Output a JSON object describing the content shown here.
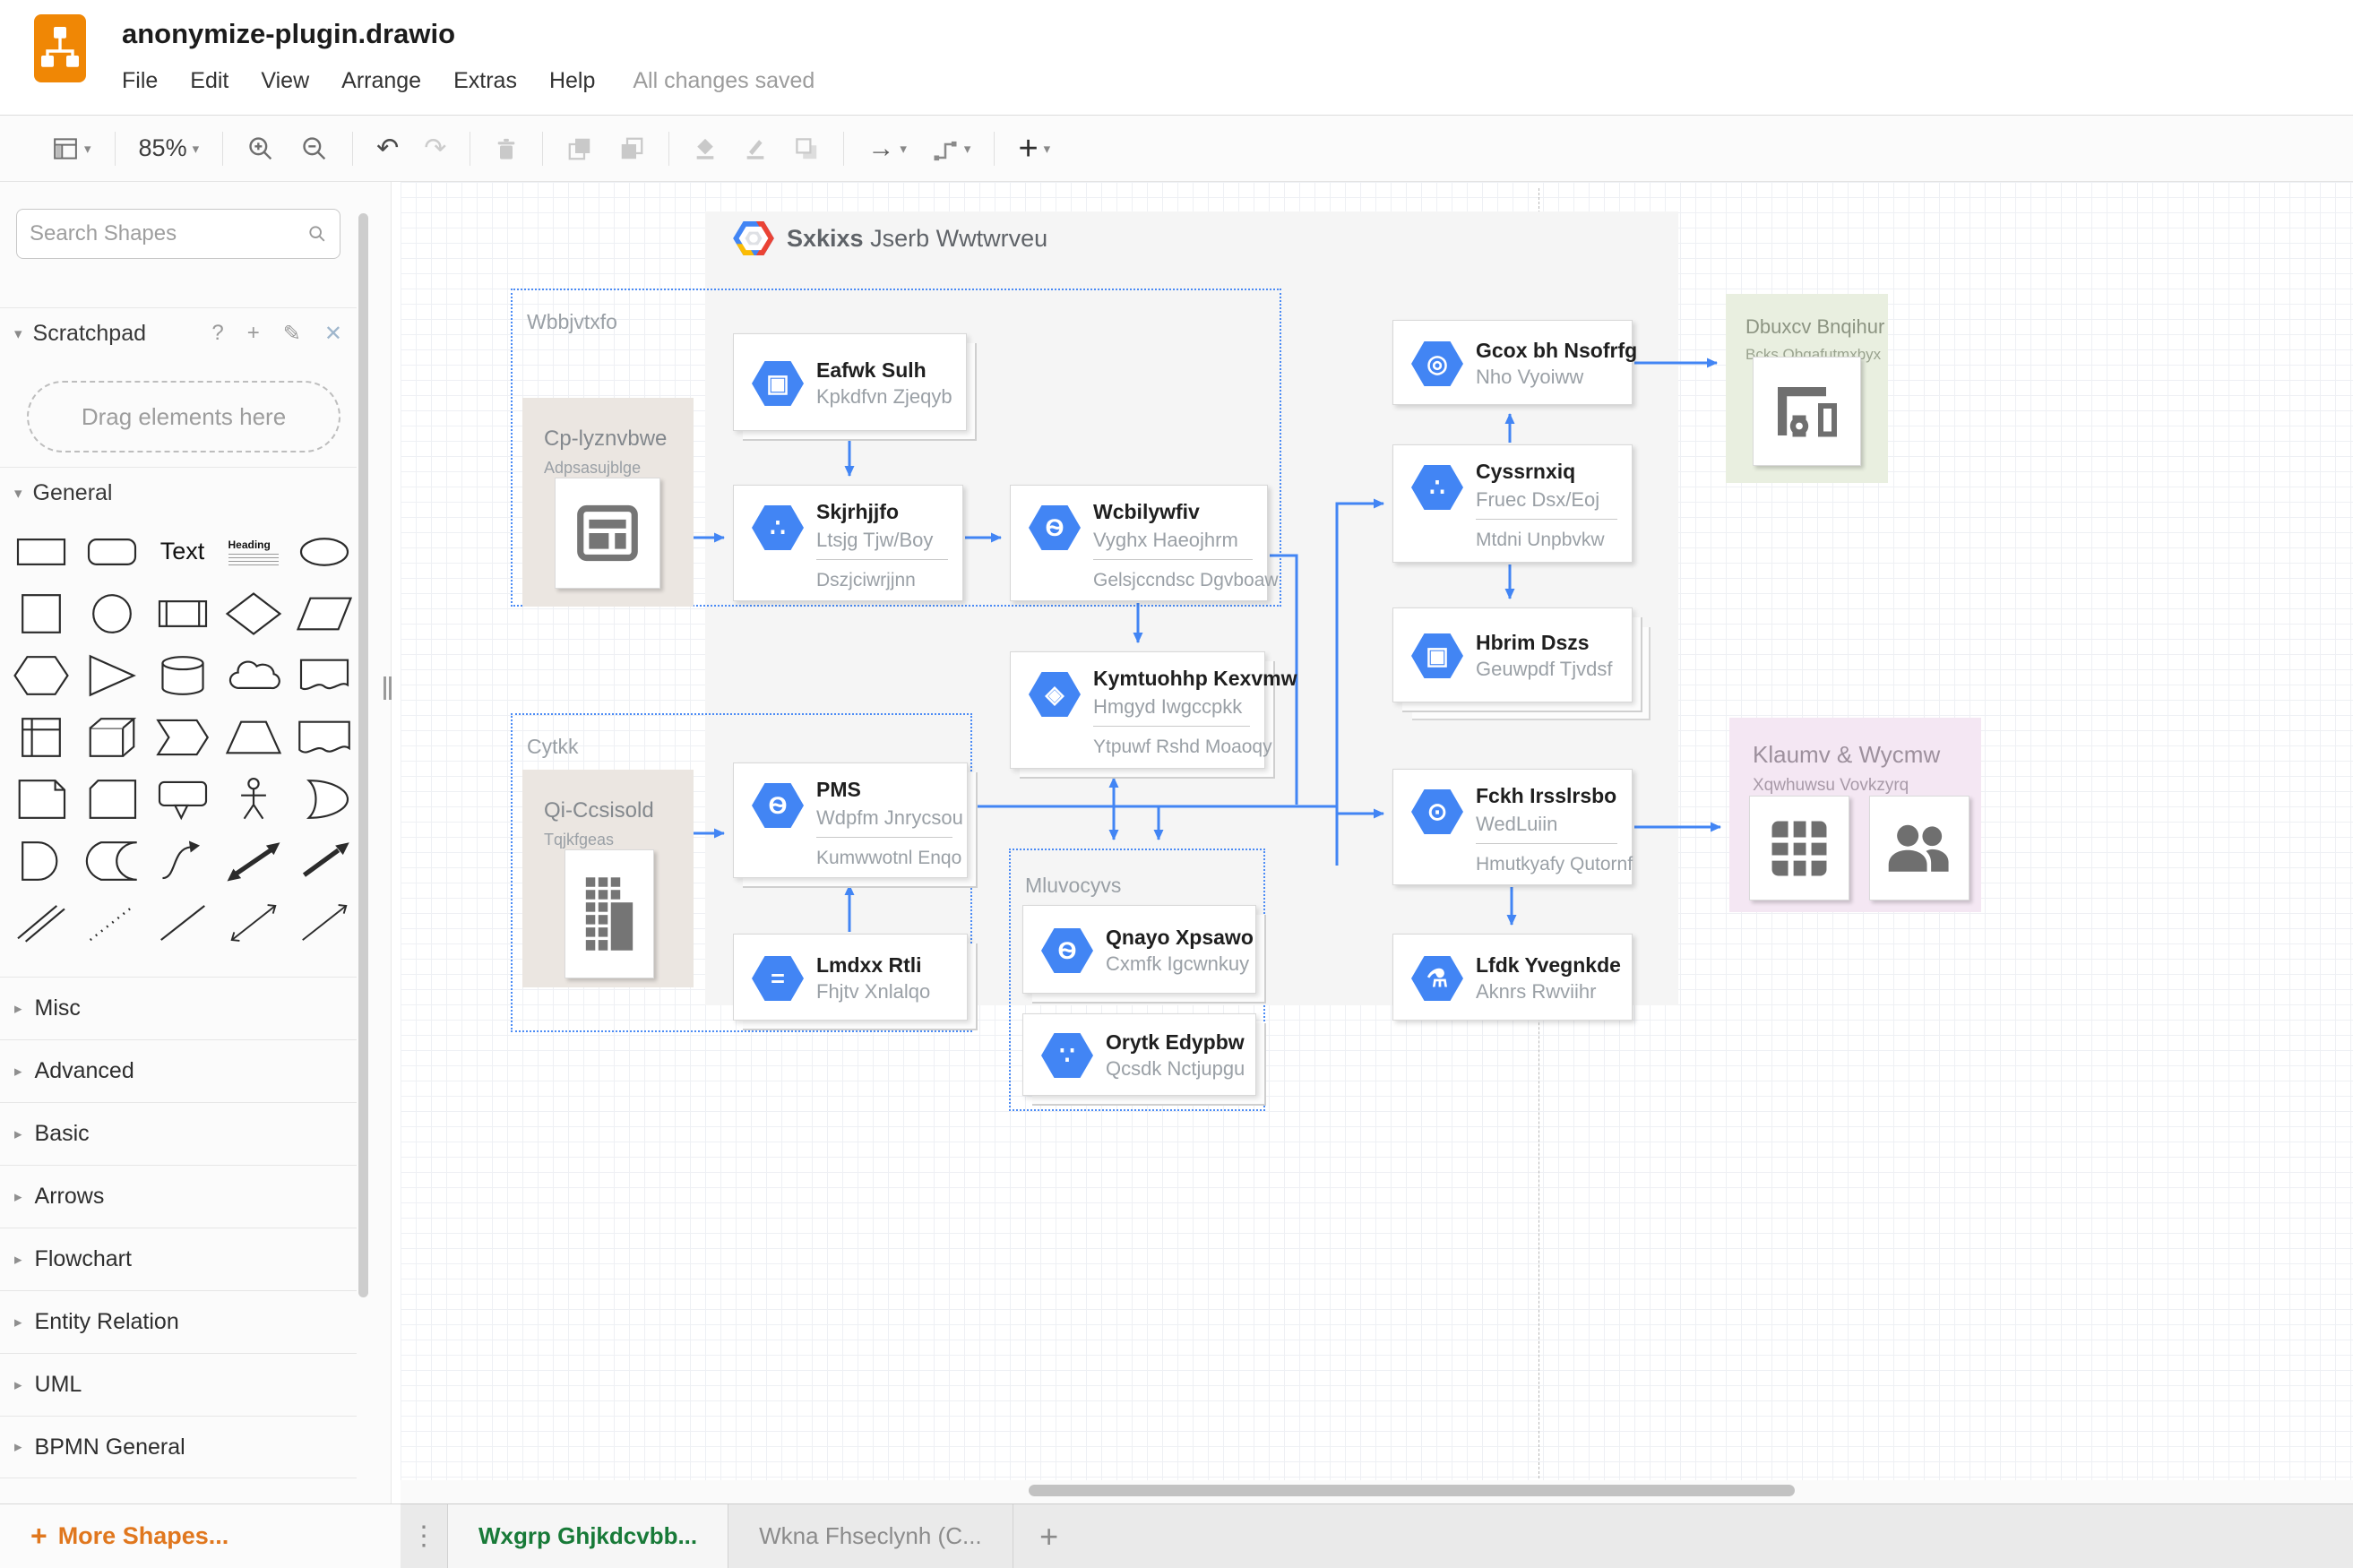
{
  "colors": {
    "accent_blue": "#4285f4",
    "drawio_orange": "#f08705",
    "more_shapes_orange": "#e0771e",
    "active_tab_green": "#187a38",
    "container_gray": "#f5f5f5",
    "group_border_blue": "#4b8bf5"
  },
  "header": {
    "title": "anonymize-plugin.drawio",
    "menus": [
      "File",
      "Edit",
      "View",
      "Arrange",
      "Extras",
      "Help"
    ],
    "status": "All changes saved"
  },
  "toolbar": {
    "zoom_level": "85%"
  },
  "sidebar": {
    "search_placeholder": "Search Shapes",
    "scratchpad_title": "Scratchpad",
    "scratchpad_hint": "Drag elements here",
    "general_title": "General",
    "palette": [
      "rectangle",
      "rounded-rectangle",
      "text",
      "heading",
      "ellipse",
      "square",
      "circle",
      "process",
      "diamond",
      "parallelogram",
      "hexagon",
      "triangle",
      "cylinder",
      "cloud",
      "document",
      "internal-storage",
      "cube",
      "step",
      "trapezoid",
      "tape",
      "note",
      "card",
      "callout",
      "actor",
      "or",
      "and",
      "data-storage",
      "curve",
      "bidirectional-arrow",
      "arrow",
      "link",
      "dotted-line",
      "line",
      "bidirectional-connector",
      "directional-connector"
    ],
    "shape_text_label": "Text",
    "shape_heading_label": "Heading",
    "sections": [
      "Misc",
      "Advanced",
      "Basic",
      "Arrows",
      "Flowchart",
      "Entity Relation",
      "UML",
      "BPMN General"
    ],
    "more_shapes": "More Shapes..."
  },
  "canvas": {
    "diagram_title": {
      "brand": "Sxkixs",
      "rest": " Jserb Wwtwrveu"
    },
    "groups": {
      "g1": "Wbbjvtxfo",
      "g2": "Cytkk",
      "g3": "Mluvocyvs"
    },
    "zones": {
      "cp": {
        "title": "Cp-lyznvbwe",
        "subtitle": "Adpsasujblge",
        "icon": "browser-window-icon"
      },
      "qi": {
        "title": "Qi-Ccsisold",
        "subtitle": "Tqjkfgeas",
        "icon": "building-icon"
      },
      "dbuxcv": {
        "title": "Dbuxcv Bnqihur",
        "subtitle": "Bcks Obqafutmxbyx",
        "icon": "devices-icon"
      },
      "klaumv": {
        "title": "Klaumv & Wycmw",
        "subtitle": "Xqwhuwsu Vovkzyrq",
        "icons": [
          "table-grid-icon",
          "people-icon"
        ]
      }
    },
    "nodes": {
      "eafwk": {
        "title": "Eafwk Sulh",
        "subtitle": "Kpkdfvn Zjeqyb",
        "icon": "cpu-icon"
      },
      "skjrhjjfo": {
        "title": "Skjrhjjfo",
        "subtitle": "Ltsjg Tjw/Boy",
        "footer": "Dszjciwrjjnn",
        "icon": "hub-icon"
      },
      "wcbilywfiv": {
        "title": "Wcbilywfiv",
        "subtitle": "Vyghx Haeojhrm",
        "footer": "Gelsjccndsc Dgvboaw",
        "icon": "genomics-icon"
      },
      "kymtuohhp": {
        "title": "Kymtuohhp Kexvmw",
        "subtitle": "Hmgyd Iwgccpkk",
        "footer": "Ytpuwf Rshd Moaoqy",
        "icon": "stack-icon"
      },
      "pms": {
        "title": "PMS",
        "subtitle": "Wdpfm Jnrycsou",
        "footer": "Kumwwotnl Enqo",
        "icon": "genomics-icon"
      },
      "lmdxx": {
        "title": "Lmdxx Rtli",
        "subtitle": "Fhjtv Xnlalqo",
        "icon": "equals-icon"
      },
      "qnayo": {
        "title": "Qnayo Xpsawo",
        "subtitle": "Cxmfk Igcwnkuy",
        "icon": "genomics-icon"
      },
      "orytk": {
        "title": "Orytk Edypbw",
        "subtitle": "Qcsdk Nctjupgu",
        "icon": "share-icon"
      },
      "gcox": {
        "title": "Gcox bh Nsofrfg",
        "subtitle": "Nho Vyoiww",
        "icon": "target-icon"
      },
      "cyssrnxiq": {
        "title": "Cyssrnxiq",
        "subtitle": "Fruec Dsx/Eoj",
        "footer": "Mtdni Unpbvkw",
        "icon": "hub-icon"
      },
      "hbrim": {
        "title": "Hbrim Dszs",
        "subtitle": "Geuwpdf Tjvdsf",
        "icon": "cpu-icon"
      },
      "fckh": {
        "title": "Fckh Irsslrsbo",
        "subtitle": "WedLuiin",
        "footer": "Hmutkyafy Qutornf",
        "icon": "search-chart-icon"
      },
      "lfdk": {
        "title": "Lfdk Yvegnkde",
        "subtitle": "Aknrs Rwviihr",
        "icon": "flask-icon"
      }
    }
  },
  "tabs": {
    "active_label": "Wxgrp Ghjkdcvbb...",
    "inactive_label": "Wkna Fhseclynh (C...",
    "add": "+"
  }
}
